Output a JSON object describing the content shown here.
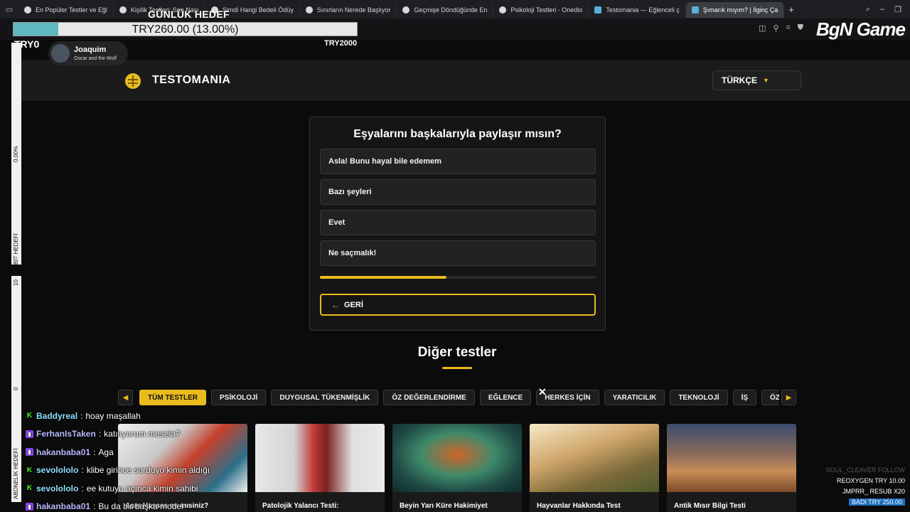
{
  "browser": {
    "tabs": [
      {
        "label": "En Popüler Testler ve Eğl",
        "active": false
      },
      {
        "label": "Kişilik Testleri: Sen Nası",
        "active": false
      },
      {
        "label": "Şimdi Hangi Bedeli Ödüy",
        "active": false
      },
      {
        "label": "Sınırların Nerede Başlıyor",
        "active": false
      },
      {
        "label": "Geçmişe Döndüğünde En",
        "active": false
      },
      {
        "label": "Psikoloji Testleri - Onedio",
        "active": false
      },
      {
        "label": "Testomania — Eğlenceli ç",
        "active": false
      },
      {
        "label": "Şımarık mıyım? | İlginç Ça",
        "active": true
      }
    ],
    "new_tab": "+"
  },
  "site": {
    "logo": "TESTOMANIA",
    "language": "TÜRKÇE",
    "quiz": {
      "question": "Eşyalarını başkalarıyla paylaşır mısın?",
      "options": [
        "Asla! Bunu hayal bile edemem",
        "Bazı şeyleri",
        "Evet",
        "Ne saçmalık!"
      ],
      "progress_fraction": 0.46,
      "back_label": "GERİ"
    },
    "other_tests_title": "Diğer testler",
    "categories": [
      "TÜM TESTLER",
      "PSİKOLOJİ",
      "DUYGUSAL TÜKENMİŞLİK",
      "ÖZ DEĞERLENDİRME",
      "EĞLENCE",
      "HERKES İÇİN",
      "YARATICILIK",
      "TEKNOLOJİ",
      "İŞ",
      "ÖZ"
    ],
    "cards": [
      {
        "title": "Aşırı Hassas mı mısiniz?"
      },
      {
        "title": "Patolojik Yalancı Testi:"
      },
      {
        "title": "Beyin Yarı Küre Hakimiyet"
      },
      {
        "title": "Hayvanlar Hakkında Test"
      },
      {
        "title": "Antik Mısır Bilgi Testi"
      }
    ]
  },
  "overlay": {
    "goal_title": "GÜNLÜK HEDEF",
    "goal_text": "TRY260.00 (13.00%)",
    "goal_fraction": 0.13,
    "goal_min": "TRY0",
    "goal_max": "TRY2000",
    "song_artist": "Joaquim",
    "song_track": "Oscar and the Wolf",
    "brand": "BgN Game",
    "bit_goal_label": "BİT HEDEFİ",
    "bit_goal_pct": "0.00%",
    "sub_goal_label": "ABONELİK HEDEFİ",
    "sub_goal_top": "10",
    "sub_goal_bottom": "0",
    "chat": [
      {
        "platform": "kick",
        "user": "Baddyreal",
        "text": "hoay maşallah"
      },
      {
        "platform": "twitch",
        "user": "FerhanIsTaken",
        "text": "katılıyorum mesela?"
      },
      {
        "platform": "twitch",
        "user": "hakanbaba01",
        "text": "Aga"
      },
      {
        "platform": "kick",
        "user": "sevolololo",
        "text": "klibe girince sorduyo kimin aldığı"
      },
      {
        "platform": "kick",
        "user": "sevolololo",
        "text": "ee kutuyu açınca kimin sahibi"
      },
      {
        "platform": "twitch",
        "user": "hakanbaba01",
        "text": "Bu da bir başka model"
      }
    ],
    "events": [
      {
        "text": "SOUL_CLEAVER  FOLLOW",
        "style": "ghost"
      },
      {
        "text": "REOXYGEN  TRY 10.00",
        "style": "normal"
      },
      {
        "text": "JMPRR_  RESUB X20",
        "style": "normal"
      },
      {
        "text": "BADI  TRY 250.00",
        "style": "hi"
      }
    ]
  },
  "colors": {
    "accent": "#e9bb1d",
    "goal_fill": "#5fb8c0",
    "twitch": "#9146ff",
    "kick": "#53fc18"
  }
}
